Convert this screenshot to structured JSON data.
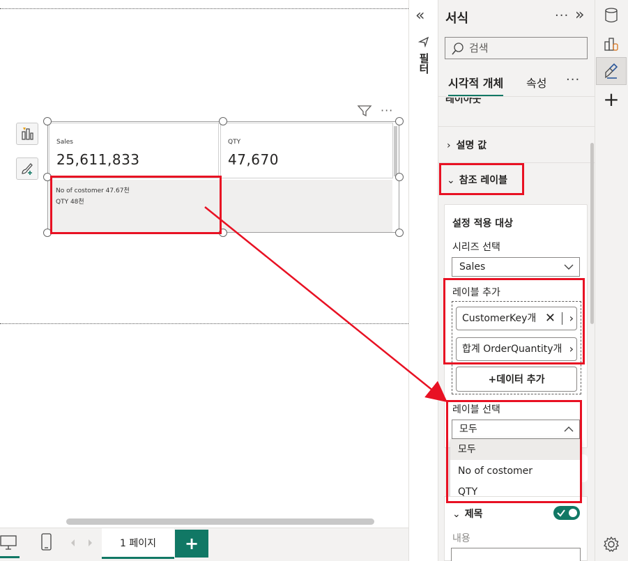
{
  "visual": {
    "card1": {
      "label": "Sales",
      "value": "25,611,833"
    },
    "card2": {
      "label": "QTY",
      "value": "47,670"
    },
    "reference_lines": [
      "No of costomer 47.67천",
      "QTY 48천"
    ]
  },
  "pagebar": {
    "page_tab": "1 페이지",
    "add_label": "+"
  },
  "filter_strip": {
    "label": "필터",
    "collapse_glyph": "«"
  },
  "pane": {
    "title": "서식",
    "search_placeholder": "검색",
    "tabs": [
      "시각적 개체",
      "속성"
    ],
    "sections": {
      "layout_partial": "레이아웃",
      "callout": "설명 값",
      "reference_label": "참조 레이블"
    },
    "apply_settings": "설정 적용 대상",
    "series_select_label": "시리즈 선택",
    "series_select_value": "Sales",
    "add_label": "레이블 추가",
    "label_chips": [
      "CustomerKey개",
      "합계 OrderQuantity개"
    ],
    "add_data_button": "+데이터 추가",
    "label_select": "레이블 선택",
    "label_select_value": "모두",
    "dropdown_options": [
      "모두",
      "No of costomer",
      "QTY"
    ],
    "title_section": "제목",
    "content_label": "내용"
  },
  "colors": {
    "accent": "#117865",
    "highlight": "#e81123"
  }
}
